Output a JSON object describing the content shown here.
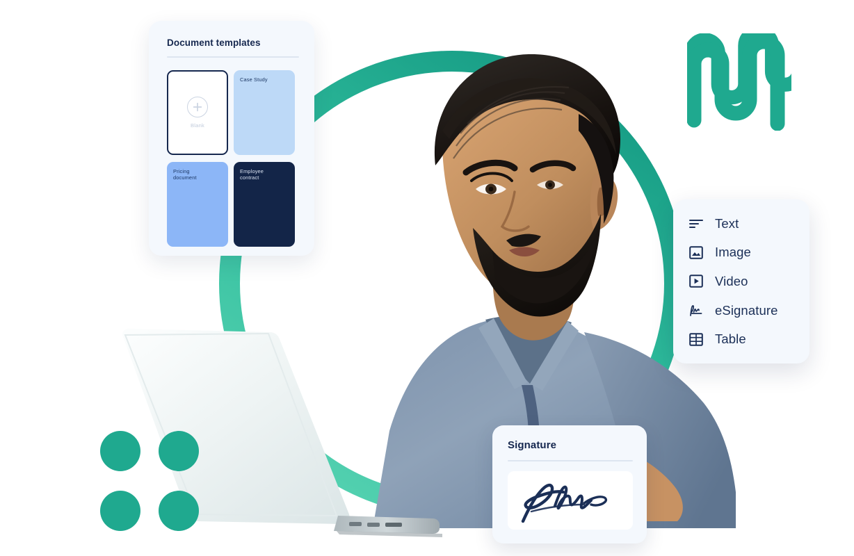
{
  "brand": {
    "logo_icon": "squiggle-wave-logo",
    "teal": "#1FA98F",
    "mint": "#4ACFAE",
    "navy": "#16284F"
  },
  "decor": {
    "ring_icon": "teal-ring",
    "dots_icon": "four-dots-grid",
    "dot_count": 4
  },
  "photo": {
    "alt": "Smiling bearded man in grey-blue shirt working on a laptop",
    "laptop_icon": "open-laptop"
  },
  "templates_panel": {
    "title": "Document templates",
    "items": [
      {
        "label": "Blank",
        "icon": "plus-circle-icon",
        "selected": true,
        "color": "#FFFFFF"
      },
      {
        "label": "Case Study",
        "icon": "",
        "selected": false,
        "color": "#BDD9F7"
      },
      {
        "label": "Pricing\ndocument",
        "icon": "",
        "selected": false,
        "color": "#8CB6F7"
      },
      {
        "label": "Employee\ncontract",
        "icon": "",
        "selected": false,
        "color": "#132548"
      }
    ],
    "item_labels": {
      "blank": "Blank",
      "case_study": "Case Study",
      "pricing_line1": "Pricing",
      "pricing_line2": "document",
      "employee_line1": "Employee",
      "employee_line2": "contract"
    }
  },
  "insert_menu": {
    "items": [
      {
        "label": "Text",
        "icon": "text-lines-icon"
      },
      {
        "label": "Image",
        "icon": "image-icon"
      },
      {
        "label": "Video",
        "icon": "video-play-icon"
      },
      {
        "label": "eSignature",
        "icon": "signature-pen-icon"
      },
      {
        "label": "Table",
        "icon": "table-grid-icon"
      }
    ]
  },
  "signature_card": {
    "title": "Signature",
    "signature_icon": "handwritten-signature"
  }
}
